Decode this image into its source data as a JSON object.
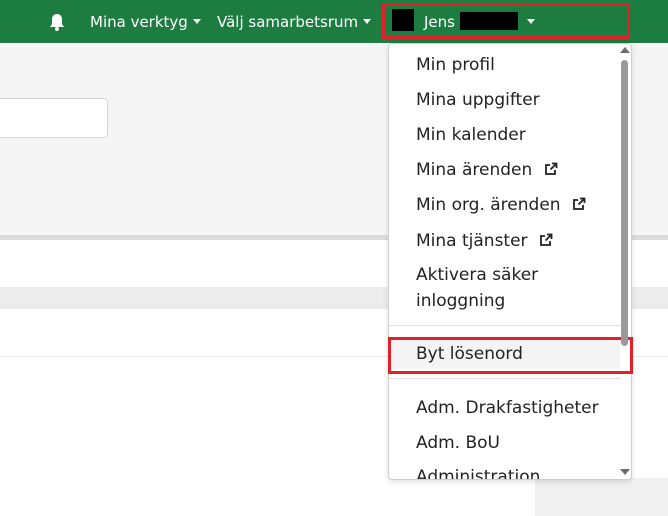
{
  "nav": {
    "tools_label": "Mina verktyg",
    "workspace_label": "Välj samarbetsrum",
    "user_label": "Jens"
  },
  "colors": {
    "nav_bg": "#1d7c3f",
    "highlight_border": "#e0202a"
  },
  "menu": {
    "items": [
      {
        "label": "Min profil"
      },
      {
        "label": "Mina uppgifter"
      },
      {
        "label": "Min kalender"
      },
      {
        "label": "Mina ärenden",
        "icon": "external-link-icon"
      },
      {
        "label": "Min org. ärenden",
        "icon": "external-link-icon"
      },
      {
        "label": "Mina tjänster",
        "icon": "external-link-icon"
      },
      {
        "label": "Aktivera säker inloggning"
      },
      {
        "label": "Byt lösenord"
      },
      {
        "label": "Adm. Drakfastigheter"
      },
      {
        "label": "Adm. BoU"
      },
      {
        "label": "Administration"
      }
    ]
  }
}
